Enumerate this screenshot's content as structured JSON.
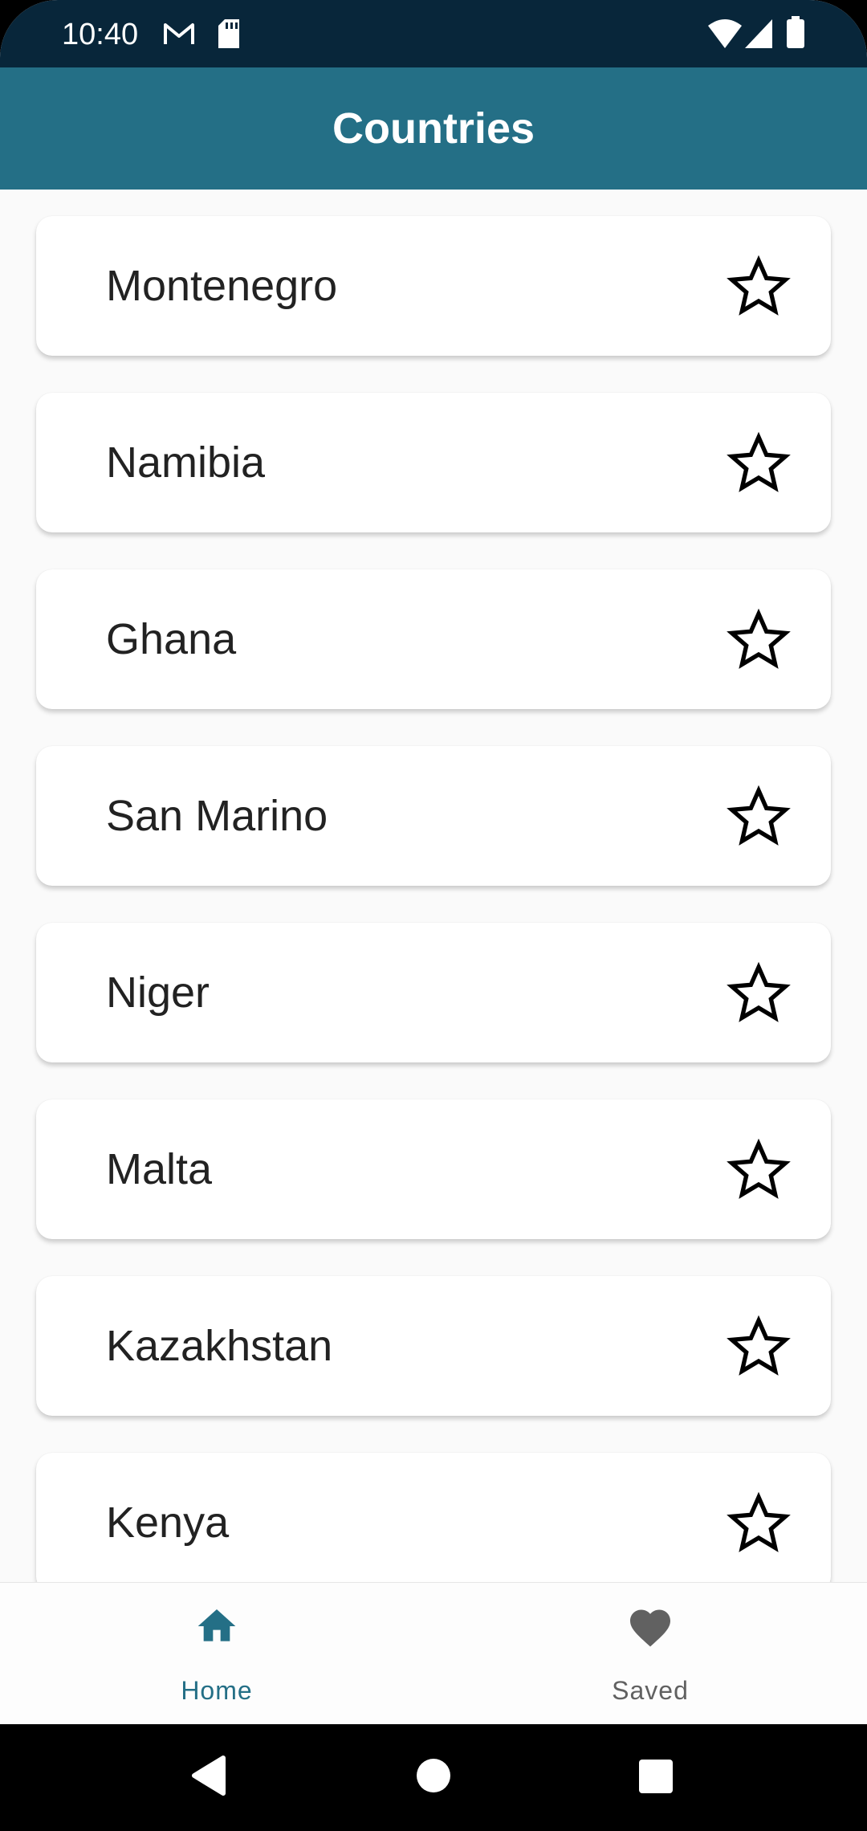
{
  "status_bar": {
    "time": "10:40",
    "icons": [
      "gmail-icon",
      "sd-card-icon",
      "wifi-icon",
      "signal-icon",
      "battery-icon"
    ]
  },
  "app_bar": {
    "title": "Countries",
    "color": "#246f86"
  },
  "countries": [
    {
      "name": "Montenegro",
      "saved": false
    },
    {
      "name": "Namibia",
      "saved": false
    },
    {
      "name": "Ghana",
      "saved": false
    },
    {
      "name": "San Marino",
      "saved": false
    },
    {
      "name": "Niger",
      "saved": false
    },
    {
      "name": "Malta",
      "saved": false
    },
    {
      "name": "Kazakhstan",
      "saved": false
    },
    {
      "name": "Kenya",
      "saved": false
    }
  ],
  "bottom_nav": {
    "items": [
      {
        "label": "Home",
        "icon": "home-icon",
        "active": true
      },
      {
        "label": "Saved",
        "icon": "heart-icon",
        "active": false
      }
    ],
    "active_color": "#246f86",
    "inactive_color": "#616161"
  },
  "system_nav": {
    "buttons": [
      "back-icon",
      "home-circle-icon",
      "recents-icon"
    ]
  }
}
